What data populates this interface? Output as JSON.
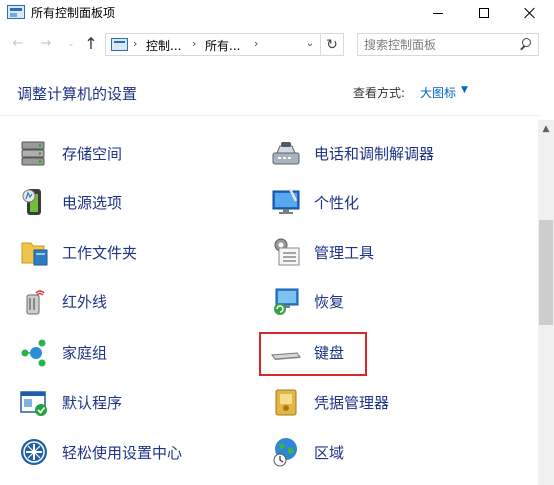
{
  "window": {
    "title": "所有控制面板项"
  },
  "address": {
    "crumbs": [
      "控制...",
      "所有..."
    ],
    "separator": "›",
    "dropdown": "⌄",
    "refresh": "↻"
  },
  "nav": {
    "back": "←",
    "forward": "→",
    "recent": "⌄",
    "up": "↑"
  },
  "search": {
    "placeholder": "搜索控制面板"
  },
  "header": {
    "title": "调整计算机的设置",
    "view_label": "查看方式:",
    "view_value": "大图标",
    "view_caret": "▼"
  },
  "scrollbar": {
    "up": "▲"
  },
  "items_left": [
    {
      "label": "存储空间",
      "icon": "storage-icon"
    },
    {
      "label": "电源选项",
      "icon": "power-icon"
    },
    {
      "label": "工作文件夹",
      "icon": "work-folders-icon"
    },
    {
      "label": "红外线",
      "icon": "infrared-icon"
    },
    {
      "label": "家庭组",
      "icon": "homegroup-icon"
    },
    {
      "label": "默认程序",
      "icon": "default-programs-icon"
    },
    {
      "label": "轻松使用设置中心",
      "icon": "ease-of-access-icon"
    }
  ],
  "items_right": [
    {
      "label": "电话和调制解调器",
      "icon": "phone-modem-icon"
    },
    {
      "label": "个性化",
      "icon": "personalization-icon"
    },
    {
      "label": "管理工具",
      "icon": "admin-tools-icon"
    },
    {
      "label": "恢复",
      "icon": "recovery-icon"
    },
    {
      "label": "键盘",
      "icon": "keyboard-icon"
    },
    {
      "label": "凭据管理器",
      "icon": "credential-manager-icon"
    },
    {
      "label": "区域",
      "icon": "region-icon"
    }
  ],
  "colors": {
    "link": "#1e3287",
    "accent": "#0066cc",
    "highlight": "#d9262a"
  }
}
